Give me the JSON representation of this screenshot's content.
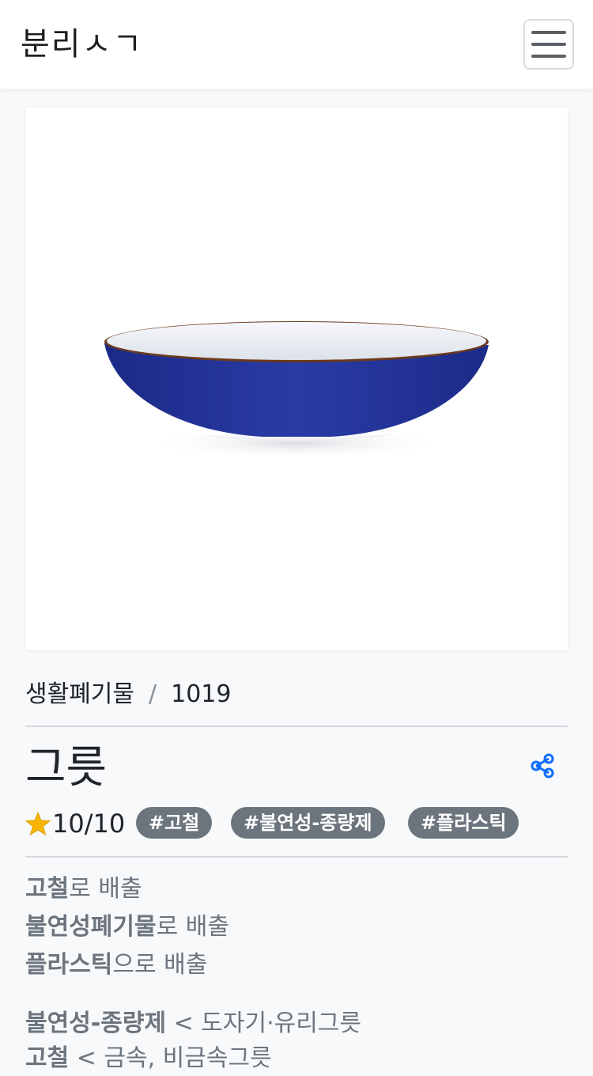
{
  "navbar": {
    "brand": "분리ㅅㄱ",
    "menu_icon": "hamburger-menu-icon"
  },
  "item": {
    "image_alt": "navy-blue-ceramic-bowl",
    "breadcrumb": {
      "category": "생활폐기물",
      "separator": "/",
      "id": "1019"
    },
    "title": "그릇",
    "share_icon": "share-icon",
    "rating": {
      "star_icon": "star-icon",
      "value": "10/10",
      "fraction": 1.0
    },
    "tags": [
      "#고철",
      "#불연성-종량제",
      "#플라스틱"
    ],
    "disposal": [
      {
        "bold": "고철",
        "rest": "로 배출"
      },
      {
        "bold": "불연성폐기물",
        "rest": "로 배출"
      },
      {
        "bold": "플라스틱",
        "rest": "으로 배출"
      }
    ],
    "related": [
      {
        "bold": "불연성-종량제",
        "rest": " < 도자기·유리그릇"
      },
      {
        "bold": "고철",
        "rest": " < 금속, 비금속그릇"
      }
    ]
  },
  "colors": {
    "accent": "#0d6efd",
    "tag_bg": "#6c757d",
    "star": "#f7b500",
    "bowl_outer": "#24349a",
    "bowl_inner": "#eef1f6"
  }
}
